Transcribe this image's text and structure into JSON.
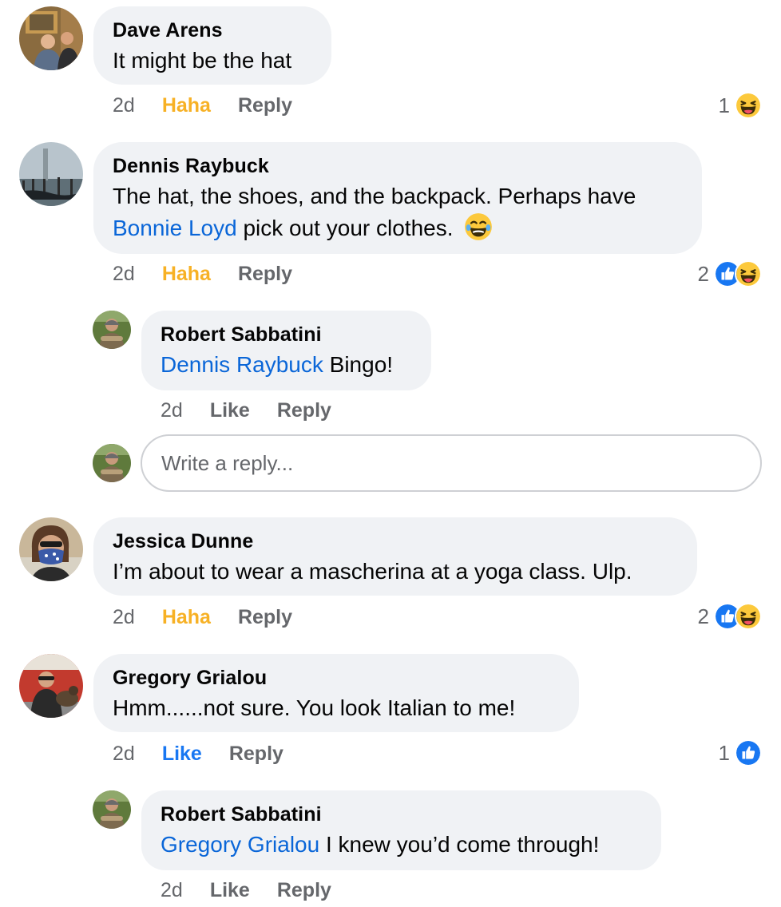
{
  "colors": {
    "bubble": "#f0f2f5",
    "mention": "#0a66d8",
    "haha": "#f7b125",
    "like": "#1877f2",
    "meta": "#65676b"
  },
  "comments": [
    {
      "author": "Dave Arens",
      "text": "It might be the hat",
      "time": "2d",
      "reaction_label": "Haha",
      "reply_label": "Reply",
      "reaction_count": "1",
      "reaction_icons": [
        "haha-icon"
      ]
    },
    {
      "author": "Dennis Raybuck",
      "text_line1": "The hat, the shoes, and the backpack. Perhaps have",
      "mention": "Bonnie Loyd",
      "text_line2": " pick out your clothes.",
      "emoji": "😂",
      "time": "2d",
      "reaction_label": "Haha",
      "reply_label": "Reply",
      "reaction_count": "2",
      "reaction_icons": [
        "like-icon",
        "haha-icon"
      ],
      "replies": [
        {
          "author": "Robert Sabbatini",
          "mention": "Dennis Raybuck",
          "text": " Bingo!",
          "time": "2d",
          "like_label": "Like",
          "reply_label": "Reply"
        }
      ],
      "reply_box": {
        "placeholder": "Write a reply..."
      }
    },
    {
      "author": "Jessica Dunne",
      "text": "I’m about to wear a mascherina at a yoga class. Ulp.",
      "time": "2d",
      "reaction_label": "Haha",
      "reply_label": "Reply",
      "reaction_count": "2",
      "reaction_icons": [
        "like-icon",
        "haha-icon"
      ]
    },
    {
      "author": "Gregory Grialou",
      "text": "Hmm......not sure.  You look Italian to me!",
      "time": "2d",
      "reaction_label": "Like",
      "reply_label": "Reply",
      "reaction_count": "1",
      "reaction_icons": [
        "like-icon"
      ],
      "replies": [
        {
          "author": "Robert Sabbatini",
          "mention": "Gregory Grialou",
          "text": " I knew you’d come through!",
          "time": "2d",
          "like_label": "Like",
          "reply_label": "Reply"
        }
      ]
    }
  ]
}
